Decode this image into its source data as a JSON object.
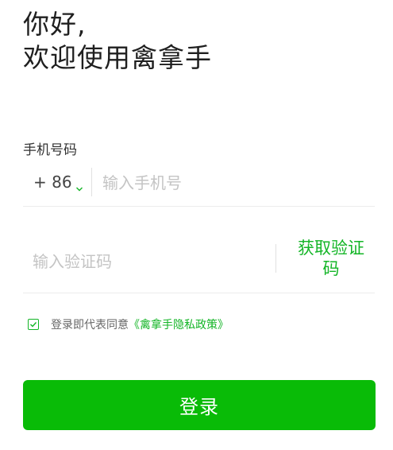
{
  "greeting": {
    "line1": "你好,",
    "line2": "欢迎使用禽拿手"
  },
  "phone": {
    "label": "手机号码",
    "country_code": "+ 86",
    "placeholder": "输入手机号"
  },
  "verification": {
    "placeholder": "输入验证码",
    "get_code_line1": "获取验证",
    "get_code_line2": "码"
  },
  "agreement": {
    "checked": true,
    "text": "登录即代表同意",
    "policy_link": "《禽拿手隐私政策》"
  },
  "login_button": "登录",
  "colors": {
    "accent": "#09bb07",
    "link_green": "#13b526",
    "placeholder": "#c4c4c4"
  }
}
